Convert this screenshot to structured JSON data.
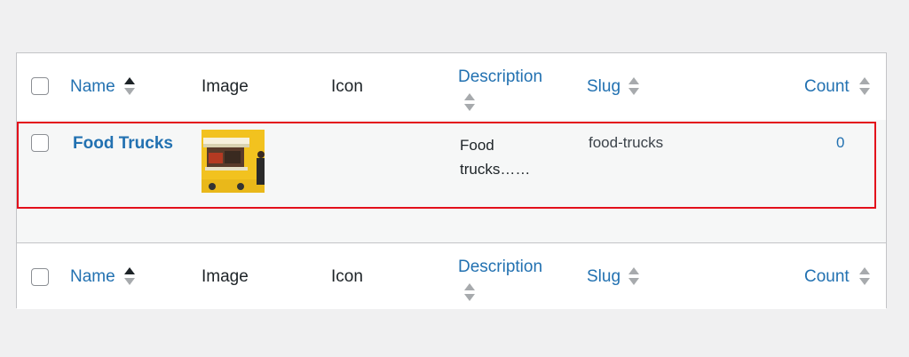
{
  "columns": {
    "name": "Name",
    "image": "Image",
    "icon": "Icon",
    "description": "Description",
    "slug": "Slug",
    "count": "Count"
  },
  "rows": [
    {
      "name": "Food Trucks",
      "image": "food-truck-thumbnail",
      "description_line1": "Food",
      "description_line2": "trucks……",
      "slug": "food-trucks",
      "count": "0"
    }
  ],
  "colors": {
    "link": "#2271b1",
    "highlight_border": "#e3101b",
    "row_background": "#f6f7f7"
  }
}
